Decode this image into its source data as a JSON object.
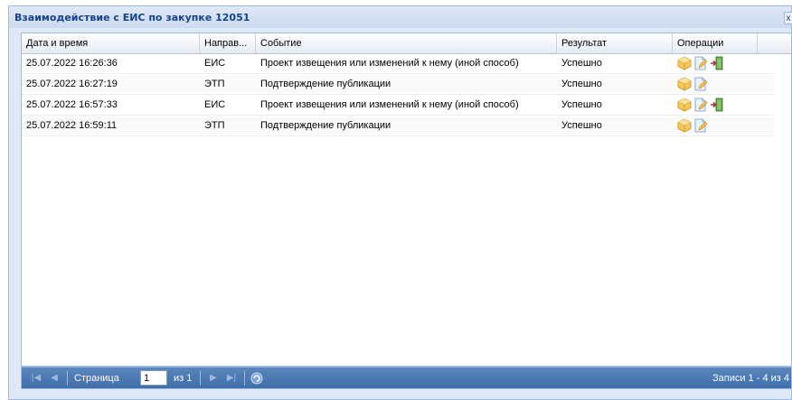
{
  "window": {
    "title": "Взаимодействие с ЕИС по закупке 12051",
    "close_label": "x"
  },
  "grid": {
    "columns": [
      "Дата и время",
      "Направ...",
      "Событие",
      "Результат",
      "Операции"
    ],
    "rows": [
      {
        "datetime": "25.07.2022 16:26:36",
        "direction": "ЕИС",
        "event": "Проект извещения или изменений к нему (иной способ)",
        "result": "Успешно",
        "operations": [
          "package-icon",
          "document-edit-icon",
          "export-door-icon"
        ]
      },
      {
        "datetime": "25.07.2022 16:27:19",
        "direction": "ЭТП",
        "event": "Подтверждение публикации",
        "result": "Успешно",
        "operations": [
          "package-icon",
          "document-edit-icon"
        ]
      },
      {
        "datetime": "25.07.2022 16:57:33",
        "direction": "ЕИС",
        "event": "Проект извещения или изменений к нему (иной способ)",
        "result": "Успешно",
        "operations": [
          "package-icon",
          "document-edit-icon",
          "export-door-icon"
        ]
      },
      {
        "datetime": "25.07.2022 16:59:11",
        "direction": "ЭТП",
        "event": "Подтверждение публикации",
        "result": "Успешно",
        "operations": [
          "package-icon",
          "document-edit-icon"
        ]
      }
    ]
  },
  "paging": {
    "page_label": "Страница",
    "page_value": "1",
    "of_label": "из 1",
    "records_label": "Записи 1 - 4 из 4"
  }
}
